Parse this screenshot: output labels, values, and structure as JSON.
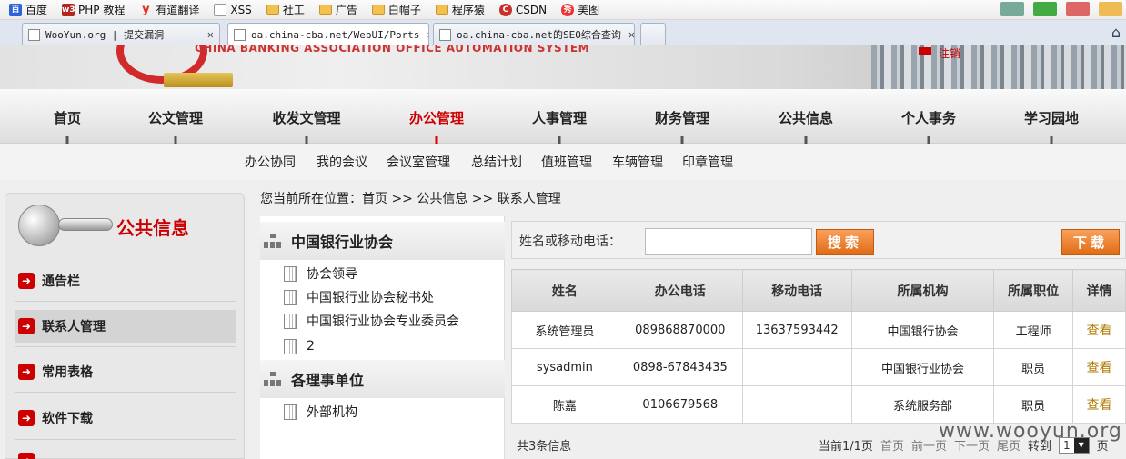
{
  "bookmarks": [
    {
      "label": "百度",
      "icon": "baidu-icon"
    },
    {
      "label": "PHP 教程",
      "icon": "w3school-icon",
      "badge": "w3"
    },
    {
      "label": "有道翻译",
      "icon": "youdao-icon",
      "badge": "y"
    },
    {
      "label": "XSS",
      "icon": "page-icon"
    },
    {
      "label": "社工",
      "icon": "folder-icon"
    },
    {
      "label": "广告",
      "icon": "folder-icon"
    },
    {
      "label": "白帽子",
      "icon": "folder-icon"
    },
    {
      "label": "程序猿",
      "icon": "folder-icon"
    },
    {
      "label": "CSDN",
      "icon": "csdn-icon"
    },
    {
      "label": "美图",
      "icon": "meitu-icon"
    }
  ],
  "tabs": [
    {
      "title": "WooYun.org | 提交漏洞",
      "active": false
    },
    {
      "title": "oa.china-cba.net/WebUI/Ports",
      "active": true
    },
    {
      "title": "oa.china-cba.net的SEO综合查询",
      "active": false
    }
  ],
  "header": {
    "org_en": "CHINA BANKING ASSOCIATION   OFFICE AUTOMATION SYSTEM",
    "right_text": "注销"
  },
  "main_nav": [
    {
      "label": "首页",
      "active": false
    },
    {
      "label": "公文管理",
      "active": false
    },
    {
      "label": "收发文管理",
      "active": false
    },
    {
      "label": "办公管理",
      "active": true
    },
    {
      "label": "人事管理",
      "active": false
    },
    {
      "label": "财务管理",
      "active": false
    },
    {
      "label": "公共信息",
      "active": false
    },
    {
      "label": "个人事务",
      "active": false
    },
    {
      "label": "学习园地",
      "active": false
    }
  ],
  "sub_nav": [
    "办公协同",
    "我的会议",
    "会议室管理",
    "总结计划",
    "值班管理",
    "车辆管理",
    "印章管理"
  ],
  "sidebar": {
    "title": "公共信息",
    "items": [
      {
        "label": "通告栏",
        "active": false
      },
      {
        "label": "联系人管理",
        "active": true
      },
      {
        "label": "常用表格",
        "active": false
      },
      {
        "label": "软件下载",
        "active": false
      }
    ]
  },
  "breadcrumb": "您当前所在位置：首页 >> 公共信息 >> 联系人管理",
  "tree": {
    "groups": [
      {
        "label": "中国银行业协会",
        "children": [
          "协会领导",
          "中国银行业协会秘书处",
          "中国银行业协会专业委员会",
          "2"
        ]
      },
      {
        "label": "各理事单位",
        "children": [
          "外部机构"
        ]
      }
    ]
  },
  "search": {
    "label": "姓名或移动电话：",
    "value": "",
    "placeholder": "",
    "button": "搜索",
    "download": "下载"
  },
  "table": {
    "headers": [
      "姓名",
      "办公电话",
      "移动电话",
      "所属机构",
      "所属职位",
      "详情"
    ],
    "rows": [
      [
        "系统管理员",
        "089868870000",
        "13637593442",
        "中国银行协会",
        "工程师",
        "查看"
      ],
      [
        "sysadmin",
        "0898-67843435",
        "",
        "中国银行业协会",
        "职员",
        "查看"
      ],
      [
        "陈嘉",
        "0106679568",
        "",
        "系统服务部",
        "职员",
        "查看"
      ]
    ]
  },
  "footer": {
    "total": "共3条信息",
    "page_info": "当前1/1页",
    "first": "首页",
    "prev": "前一页",
    "next": "下一页",
    "last": "尾页",
    "goto": "转到",
    "page_value": "1",
    "page_suffix": "页"
  },
  "watermark": "www.wooyun.org",
  "colors": {
    "accent_red": "#c00000",
    "button_orange": "#e87a2a"
  }
}
